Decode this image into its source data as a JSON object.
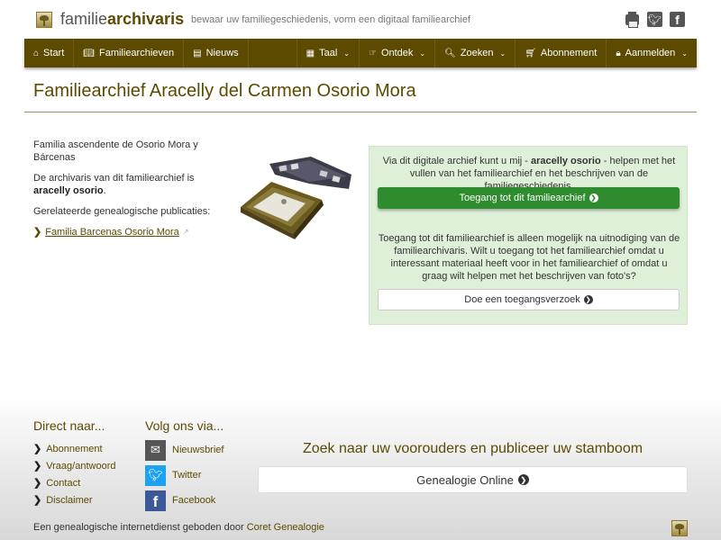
{
  "header": {
    "brand_prefix": "familie",
    "brand_bold": "archivaris",
    "tagline": "bewaar uw familiegeschiedenis, vorm een digitaal familiearchief",
    "icons": [
      "print-icon",
      "twitter-icon",
      "facebook-icon"
    ]
  },
  "nav": {
    "start": "Start",
    "familiearchieven": "Familiearchieven",
    "nieuws": "Nieuws",
    "taal": "Taal",
    "ontdek": "Ontdek",
    "zoeken": "Zoeken",
    "abonnement": "Abonnement",
    "aanmelden": "Aanmelden"
  },
  "page": {
    "title": "Familiearchief Aracelly del Carmen Osorio Mora"
  },
  "left": {
    "description": "Familia ascendente de Osorio Mora y Bárcenas",
    "archivist_prefix": "De archivaris van dit familiearchief is ",
    "archivist_name": "aracelly osorio",
    "archivist_suffix": ".",
    "publications_label": "Gerelateerde genealogische publicaties:",
    "publication_link": "Familia Barcenas Osorio Mora"
  },
  "panel": {
    "intro_prefix": "Via dit digitale archief kunt u mij - ",
    "intro_name": "aracelly osorio",
    "intro_suffix": " - helpen met het vullen van het familiearchief en het beschrijven van de familiegeschiedenis.",
    "access_button": "Toegang tot dit familiearchief",
    "invite_text": "Toegang tot dit familiearchief is alleen mogelijk na uitnodiging van de familiearchivaris. Wilt u toegang tot het familiearchief omdat u interessant materiaal heeft voor in het familiearchief of omdat u graag wilt helpen met het beschrijven van foto's?",
    "request_button": "Doe een toegangsverzoek"
  },
  "footer": {
    "direct_heading": "Direct naar...",
    "direct_links": [
      "Abonnement",
      "Vraag/antwoord",
      "Contact",
      "Disclaimer"
    ],
    "follow_heading": "Volg ons via...",
    "social": [
      "Nieuwsbrief",
      "Twitter",
      "Facebook"
    ],
    "promo": "Zoek naar uw voorouders en publiceer uw stamboom",
    "promo_button": "Genealogie Online",
    "credit_prefix": "Een genealogische internetdienst geboden door ",
    "credit_link": "Coret Genealogie"
  },
  "colors": {
    "brand": "#5c4a00",
    "panel_bg": "#dff0d8",
    "button_green": "#2e8b2e"
  }
}
